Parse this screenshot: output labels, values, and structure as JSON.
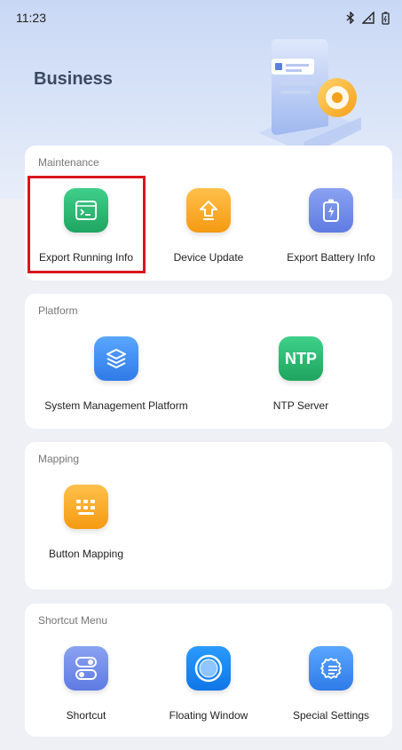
{
  "status_bar": {
    "time": "11:23",
    "icons": [
      "bluetooth-icon",
      "signal-icon",
      "battery-icon"
    ]
  },
  "page": {
    "title": "Business"
  },
  "sections": [
    {
      "title": "Maintenance",
      "items": [
        {
          "label": "Export Running Info",
          "icon": "terminal-icon",
          "color": "#2bb673"
        },
        {
          "label": "Device Update",
          "icon": "upload-arrow-icon",
          "color": "#f7a21b"
        },
        {
          "label": "Export Battery Info",
          "icon": "battery-charge-icon",
          "color": "#6b86e8"
        }
      ]
    },
    {
      "title": "Platform",
      "items": [
        {
          "label": "System Management Platform",
          "icon": "layers-icon",
          "color": "#3f8cf0"
        },
        {
          "label": "NTP Server",
          "icon": "ntp-icon",
          "icon_text": "NTP",
          "color": "#27b36b"
        }
      ]
    },
    {
      "title": "Mapping",
      "items": [
        {
          "label": "Button Mapping",
          "icon": "keyboard-icon",
          "color": "#f7a21b"
        }
      ]
    },
    {
      "title": "Shortcut Menu",
      "items": [
        {
          "label": "Shortcut",
          "icon": "toggle-icon",
          "color": "#6b86e8"
        },
        {
          "label": "Floating Window",
          "icon": "floating-circle-icon",
          "color": "#1e88f5"
        },
        {
          "label": "Special Settings",
          "icon": "gear-list-icon",
          "color": "#3f8cf0"
        }
      ]
    }
  ],
  "highlight_color": "#d9151f"
}
